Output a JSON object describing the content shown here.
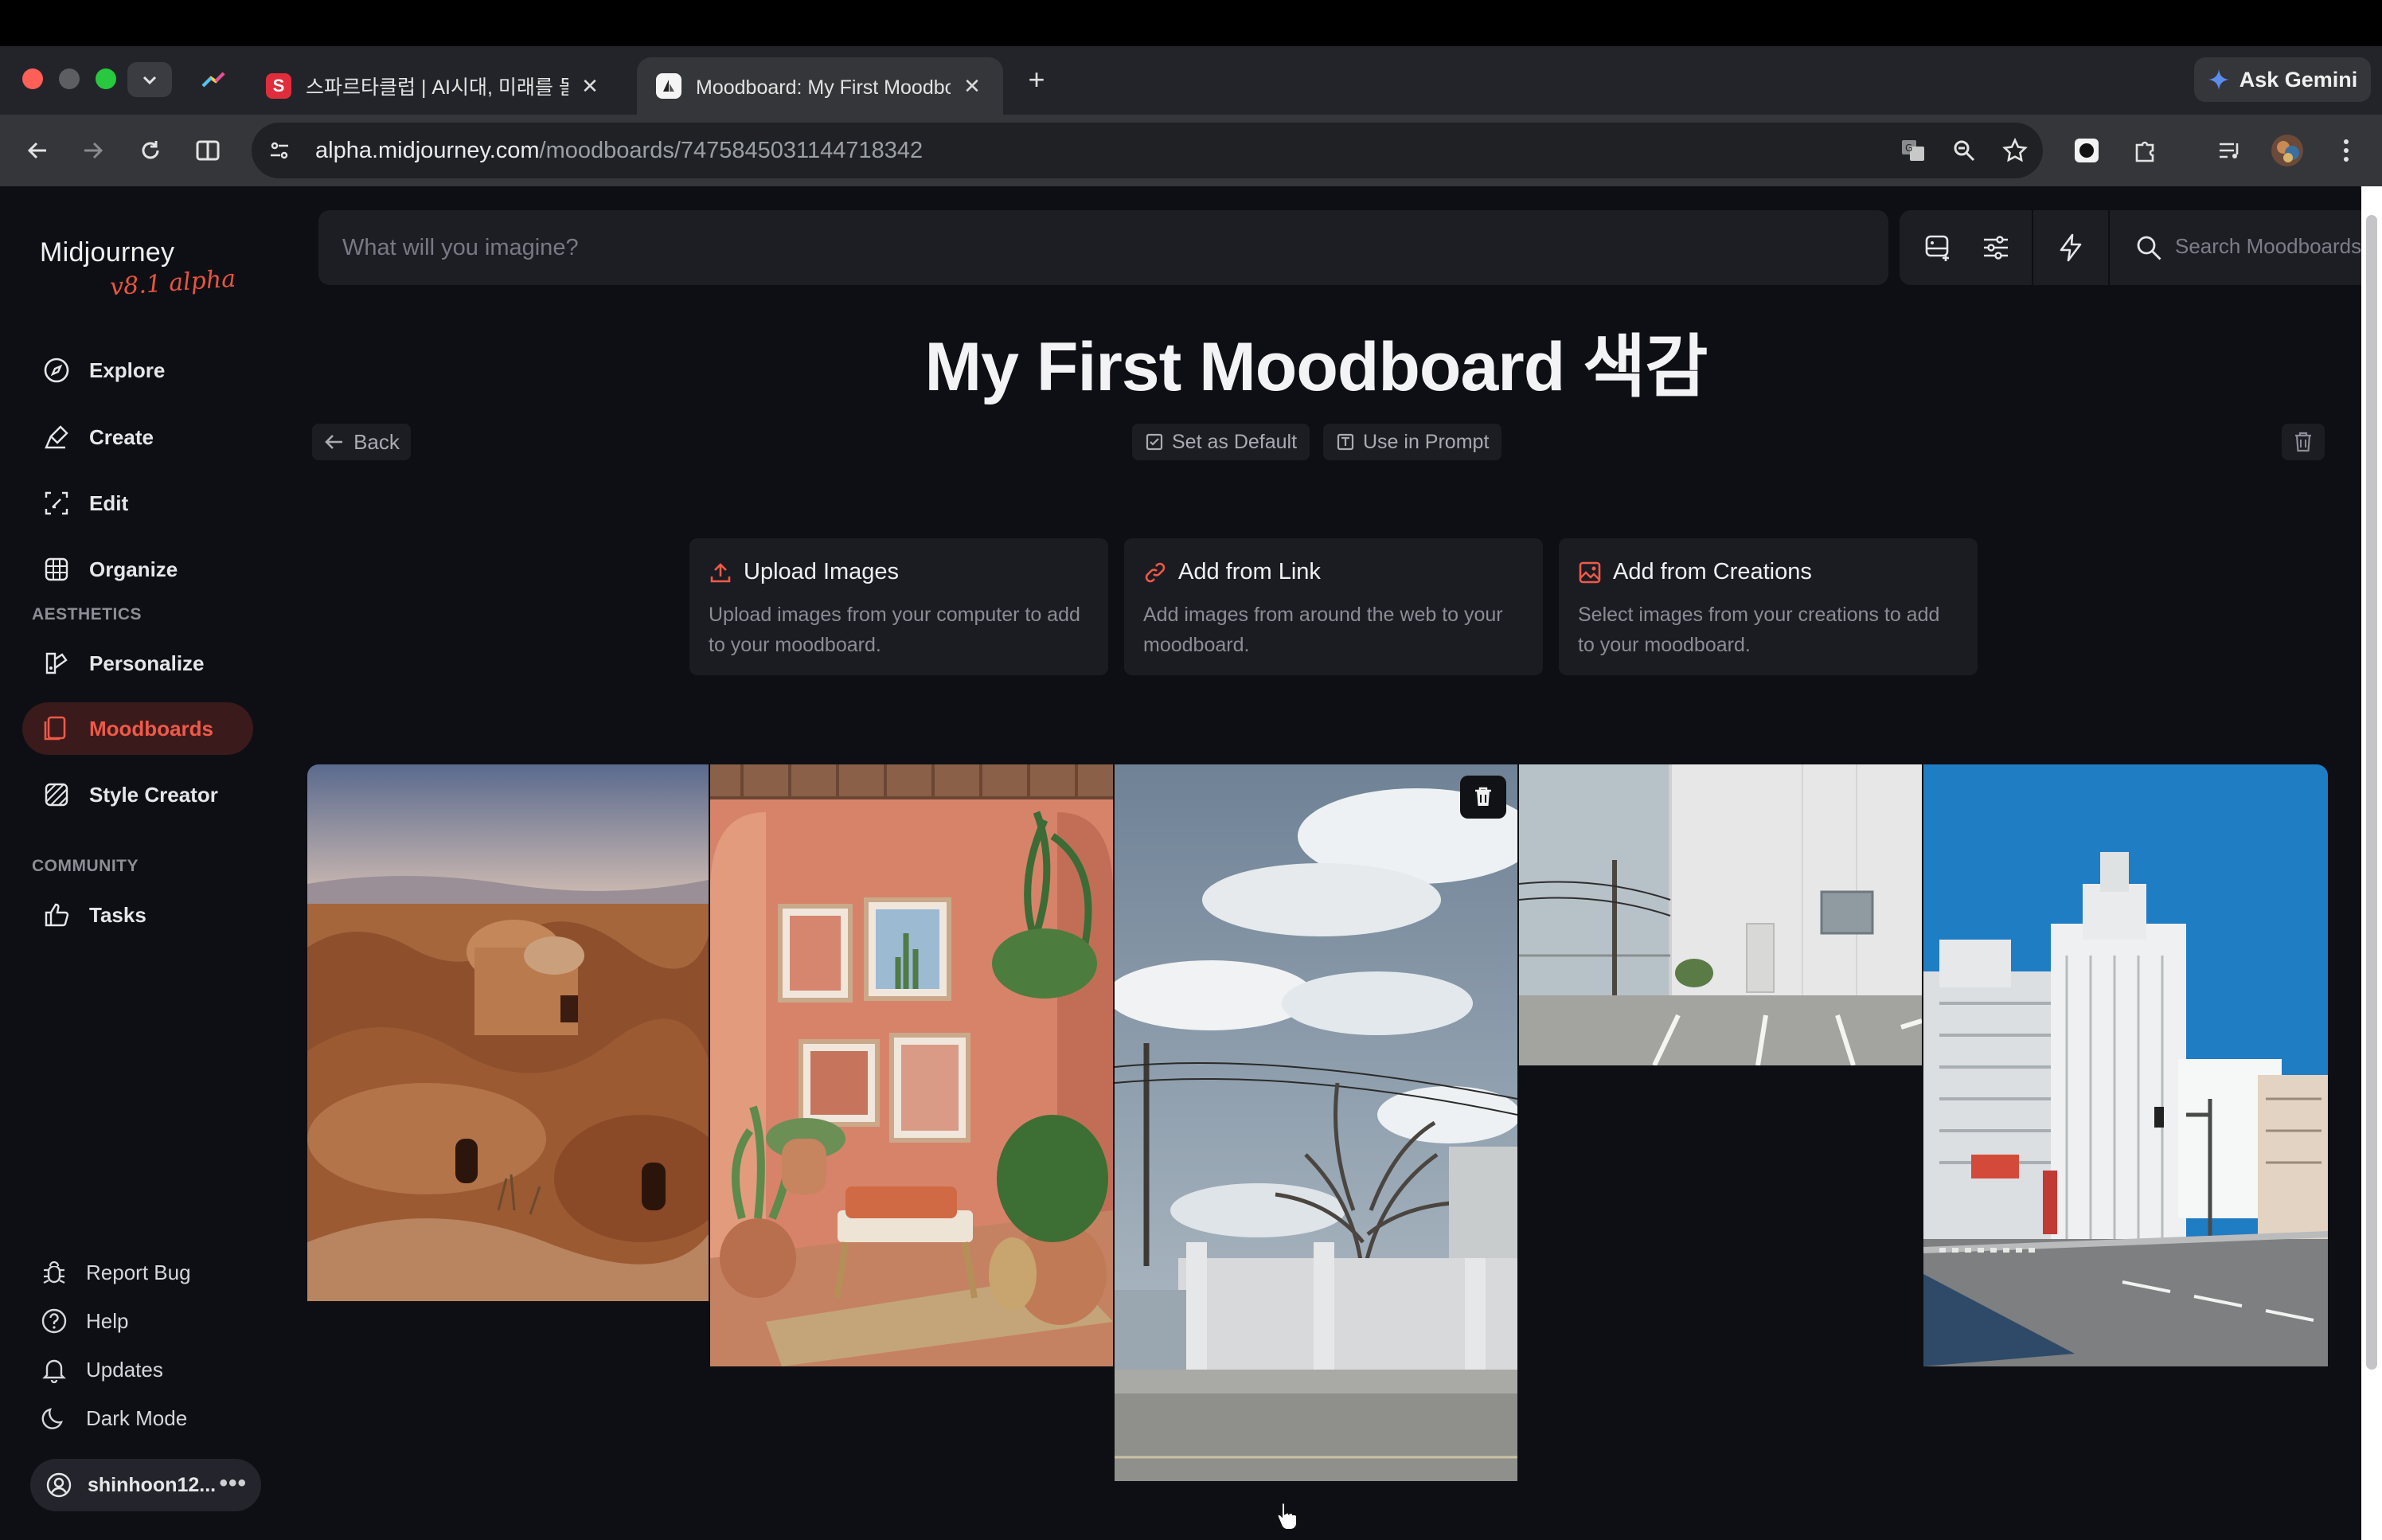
{
  "browser": {
    "tabs": [
      {
        "title": "스파르타클럽 | AI시대, 미래를 돌파",
        "favicon": "S",
        "active": false
      },
      {
        "title": "Moodboard: My First Moodboard 색감",
        "favicon": "MJ",
        "active": true
      }
    ],
    "url_host": "alpha.midjourney.com",
    "url_path": "/moodboards/7475845031144718342",
    "gemini_label": "Ask Gemini"
  },
  "sidebar": {
    "brand": "Midjourney",
    "version": "v8.1 alpha",
    "nav": [
      {
        "label": "Explore",
        "icon": "compass-icon"
      },
      {
        "label": "Create",
        "icon": "brush-icon"
      },
      {
        "label": "Edit",
        "icon": "edit-frame-icon"
      },
      {
        "label": "Organize",
        "icon": "grid-icon"
      }
    ],
    "aesthetics_label": "AESTHETICS",
    "aesthetics": [
      {
        "label": "Personalize",
        "icon": "personalize-icon"
      },
      {
        "label": "Moodboards",
        "icon": "moodboard-icon",
        "active": true
      },
      {
        "label": "Style Creator",
        "icon": "style-creator-icon"
      }
    ],
    "community_label": "COMMUNITY",
    "community": [
      {
        "label": "Tasks",
        "icon": "thumbs-up-icon"
      }
    ],
    "footer": [
      {
        "label": "Report Bug",
        "icon": "bug-icon"
      },
      {
        "label": "Help",
        "icon": "help-icon"
      },
      {
        "label": "Updates",
        "icon": "bell-icon"
      },
      {
        "label": "Dark Mode",
        "icon": "moon-icon"
      }
    ],
    "user": "shinhoon12..."
  },
  "prompt": {
    "placeholder": "What will you imagine?"
  },
  "search": {
    "placeholder": "Search Moodboards"
  },
  "page": {
    "title": "My First Moodboard 색감",
    "back_label": "Back",
    "set_default_label": "Set as Default",
    "use_in_prompt_label": "Use in Prompt"
  },
  "cards": [
    {
      "title": "Upload Images",
      "desc": "Upload images from your computer to add to your moodboard.",
      "icon": "upload-icon"
    },
    {
      "title": "Add from Link",
      "desc": "Add images from around the web to your moodboard.",
      "icon": "link-icon"
    },
    {
      "title": "Add from Creations",
      "desc": "Select images from your creations to add to your moodboard.",
      "icon": "creations-icon"
    }
  ],
  "images": [
    {
      "subject": "desert adobe dwellings"
    },
    {
      "subject": "terracotta interior with plants"
    },
    {
      "subject": "white wall with tree and sky"
    },
    {
      "subject": "white building parking lot"
    },
    {
      "subject": "city street with white buildings"
    }
  ],
  "colors": {
    "accent": "#ef5a48",
    "background": "#0e0f14",
    "panel": "#1d1e24"
  }
}
